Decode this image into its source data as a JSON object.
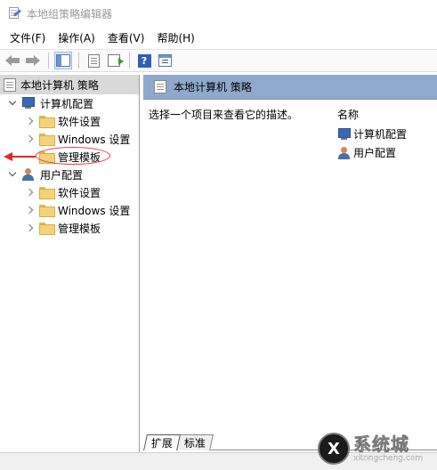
{
  "window": {
    "title": "本地组策略编辑器",
    "title_icon": "policy-editor-icon"
  },
  "menu": {
    "items": [
      "文件(F)",
      "操作(A)",
      "查看(V)",
      "帮助(H)"
    ]
  },
  "toolbar": {
    "buttons": [
      "back-icon",
      "forward-icon",
      "show-hide-tree-icon",
      "properties-doc-icon",
      "export-list-icon",
      "help-icon",
      "show-hide-action-pane-icon"
    ],
    "help_glyph": "?"
  },
  "tree": {
    "root": "本地计算机 策略",
    "computer": {
      "label": "计算机配置",
      "children": [
        "软件设置",
        "Windows 设置",
        "管理模板"
      ]
    },
    "user": {
      "label": "用户配置",
      "children": [
        "软件设置",
        "Windows 设置",
        "管理模板"
      ]
    }
  },
  "right_pane": {
    "header": "本地计算机 策略",
    "description": "选择一个项目来查看它的描述。",
    "column_header": "名称",
    "items": [
      "计算机配置",
      "用户配置"
    ]
  },
  "tabs": [
    "扩展",
    "标准"
  ],
  "watermark": {
    "badge": "X",
    "cn": "系统城",
    "en": "xitongcheng.com"
  },
  "colors": {
    "header_blue": "#8fa9cc",
    "selected_gray": "#d9d9d9",
    "annotation_red": "#e52626"
  }
}
